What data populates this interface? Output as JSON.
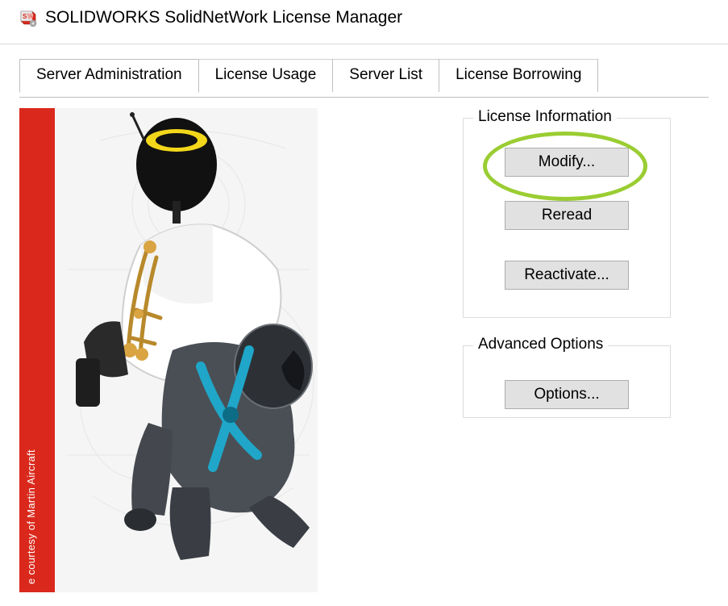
{
  "window": {
    "title": "SOLIDWORKS SolidNetWork License Manager"
  },
  "tabs": [
    {
      "label": "Server Administration",
      "active": true
    },
    {
      "label": "License Usage",
      "active": false
    },
    {
      "label": "Server List",
      "active": false
    },
    {
      "label": "License Borrowing",
      "active": false
    }
  ],
  "promo": {
    "credit": "e courtesy of Martin Aircraft"
  },
  "groups": {
    "license": {
      "title": "License Information",
      "buttons": {
        "modify": "Modify...",
        "reread": "Reread",
        "reactivate": "Reactivate..."
      }
    },
    "advanced": {
      "title": "Advanced Options",
      "buttons": {
        "options": "Options..."
      }
    }
  }
}
